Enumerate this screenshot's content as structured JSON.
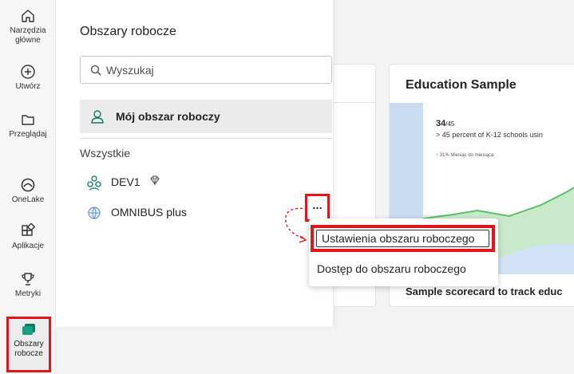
{
  "rail": {
    "items": [
      {
        "label_1": "Narzędzia",
        "label_2": "główne",
        "icon": "home-icon"
      },
      {
        "label": "Utwórz",
        "icon": "plus-circle-icon"
      },
      {
        "label": "Przeglądaj",
        "icon": "folder-icon"
      },
      {
        "label": "OneLake",
        "icon": "onelake-icon"
      },
      {
        "label": "Aplikacje",
        "icon": "apps-icon"
      },
      {
        "label": "Metryki",
        "icon": "trophy-icon"
      }
    ],
    "active": {
      "label_1": "Obszary",
      "label_2": "robocze",
      "icon": "workspaces-icon"
    }
  },
  "panel": {
    "title": "Obszary robocze",
    "search_placeholder": "Wyszukaj",
    "my_workspace": "Mój obszar roboczy",
    "section_label": "Wszystkie",
    "workspaces": [
      {
        "name": "DEV1",
        "icon": "group-icon",
        "badge": "diamond-badge-icon"
      },
      {
        "name": "OMNIBUS plus",
        "icon": "workspace-globe-icon"
      }
    ],
    "more_label": "..."
  },
  "menu": {
    "item_settings": "Ustawienia obszaru roboczego",
    "item_access": "Dostęp do obszaru roboczego"
  },
  "card": {
    "title": "Education Sample",
    "kpi_value": "34",
    "kpi_total": "/45",
    "kpi_desc": "> 45 percent of K-12 schools usin",
    "kpi_sub": "↑ 31% Miesiąc do miesiąca",
    "footer": "Sample scorecard to track educ"
  },
  "colors": {
    "highlight": "#e0161b",
    "accent": "#117865"
  }
}
